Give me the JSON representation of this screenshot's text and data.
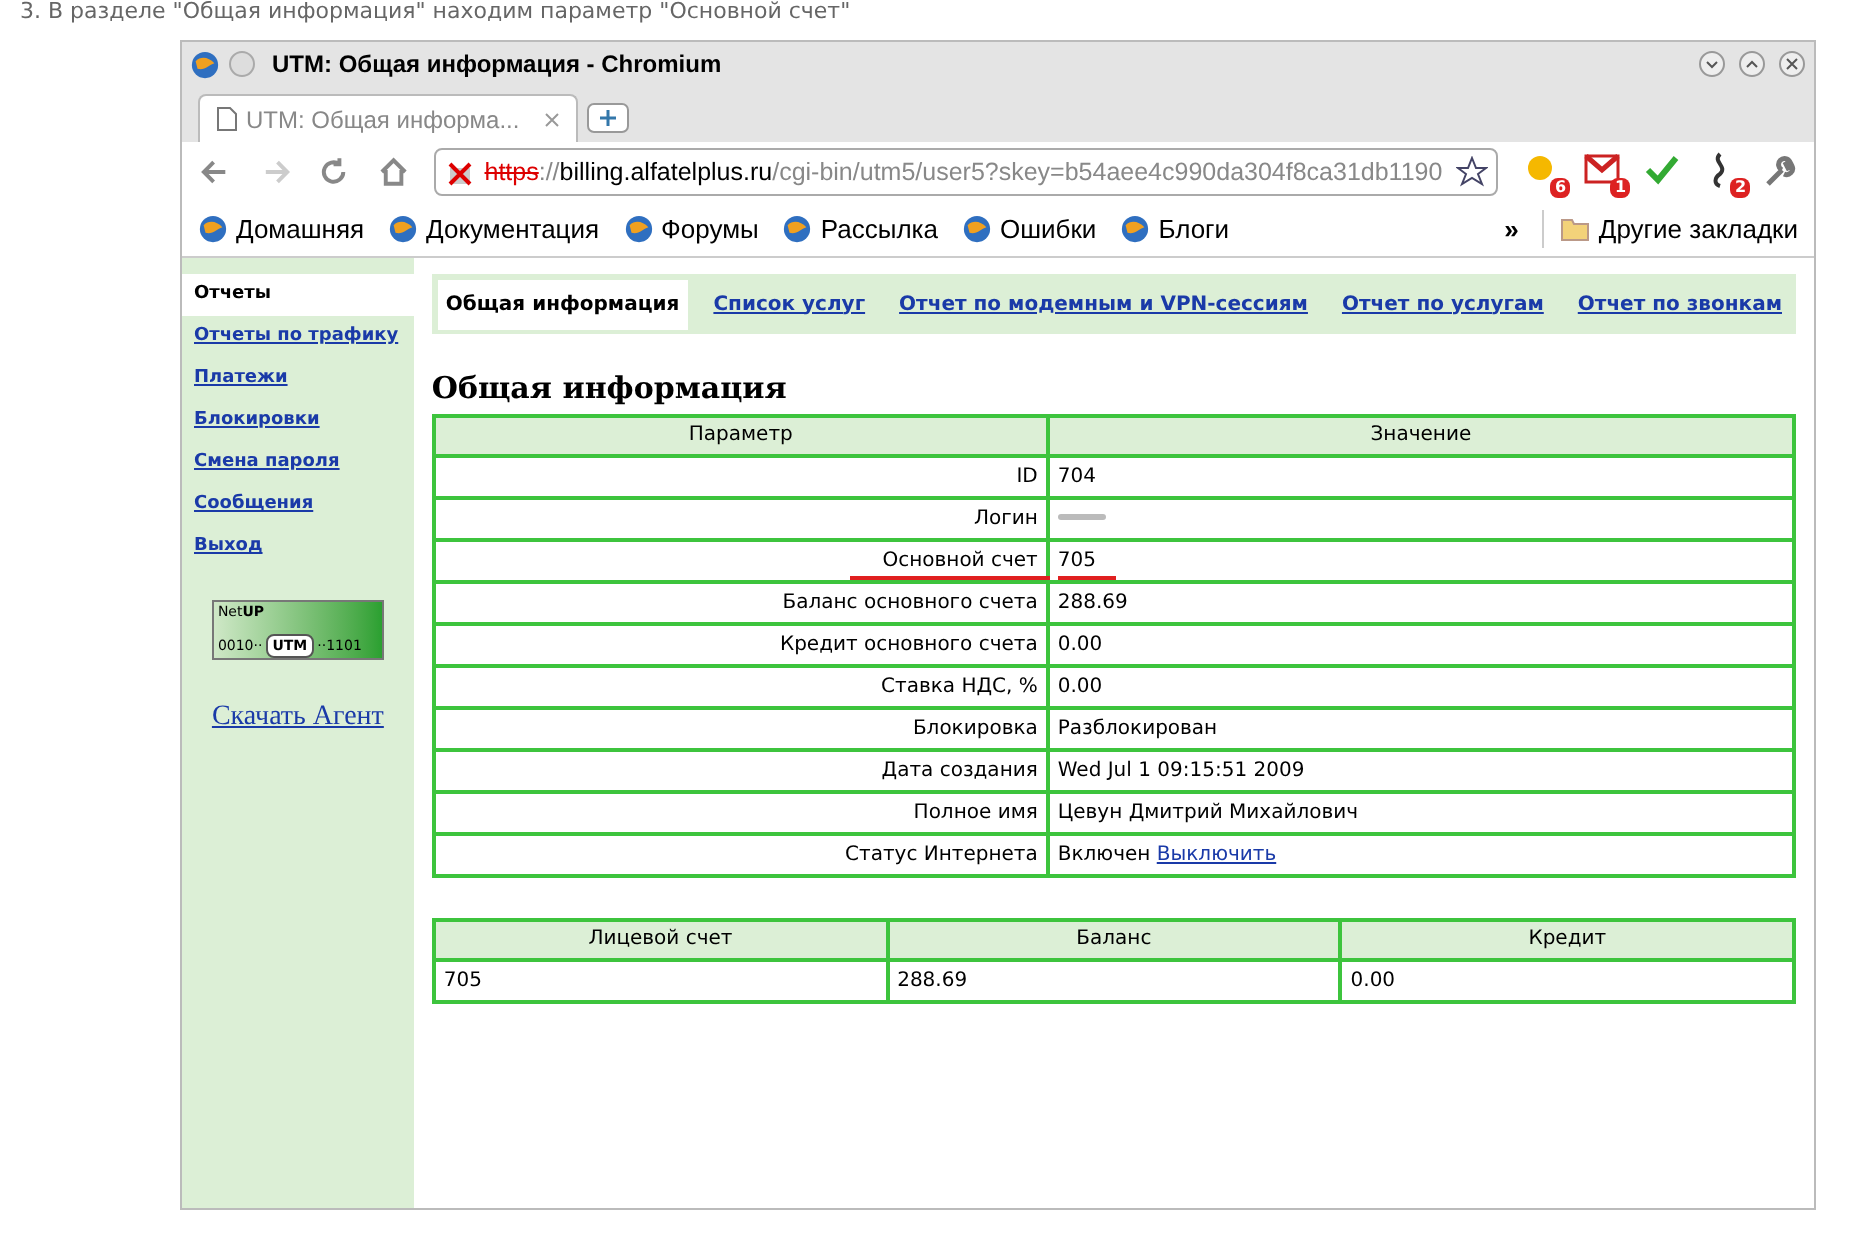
{
  "caption": "3. В разделе \"Общая информация\" находим параметр \"Основной счет\"",
  "browser": {
    "title": "UTM: Общая информация - Chromium",
    "tab_title": "UTM: Общая информа...",
    "url": {
      "scheme": "https",
      "separator": "://",
      "host": "billing.alfatelplus.ru",
      "path": "/cgi-bin/utm5/user5?skey=b54aee4c990da304f8ca31db1190"
    },
    "extensions": [
      {
        "kind": "weather",
        "badge": "6"
      },
      {
        "kind": "mail",
        "badge": "1"
      },
      {
        "kind": "check"
      },
      {
        "kind": "music",
        "badge": "2"
      }
    ],
    "bookmarks": [
      "Домашняя",
      "Документация",
      "Форумы",
      "Рассылка",
      "Ошибки",
      "Блоги"
    ],
    "overflow": "»",
    "other_bookmarks": "Другие закладки"
  },
  "sidebar": {
    "items": [
      {
        "label": "Отчеты",
        "selected": true
      },
      {
        "label": "Отчеты по трафику",
        "selected": false
      },
      {
        "label": "Платежи",
        "selected": false
      },
      {
        "label": "Блокировки",
        "selected": false
      },
      {
        "label": "Смена пароля",
        "selected": false
      },
      {
        "label": "Сообщения",
        "selected": false
      },
      {
        "label": "Выход",
        "selected": false
      }
    ],
    "logo": {
      "brand_light": "Net",
      "brand_bold": "UP",
      "left": "0010··",
      "badge": "UTM",
      "right": "··1101"
    },
    "agent_link": "Скачать Агент"
  },
  "tabs": [
    {
      "label": "Общая информация",
      "selected": true
    },
    {
      "label": "Список услуг",
      "selected": false
    },
    {
      "label": "Отчет по модемным и VPN-сессиям",
      "selected": false
    },
    {
      "label": "Отчет по услугам",
      "selected": false
    },
    {
      "label": "Отчет по звонкам",
      "selected": false
    }
  ],
  "heading": "Общая информация",
  "info_table": {
    "columns": [
      "Параметр",
      "Значение"
    ],
    "rows": [
      {
        "parameter": "ID",
        "kind": "text",
        "value": "704",
        "underlined": false
      },
      {
        "parameter": "Логин",
        "kind": "blurred",
        "underlined": false
      },
      {
        "parameter": "Основной счет",
        "kind": "text",
        "value": "705",
        "underlined": true
      },
      {
        "parameter": "Баланс основного счета",
        "kind": "text",
        "value": "288.69",
        "underlined": false
      },
      {
        "parameter": "Кредит основного счета",
        "kind": "text",
        "value": "0.00",
        "underlined": false
      },
      {
        "parameter": "Ставка НДС, %",
        "kind": "text",
        "value": "0.00",
        "underlined": false
      },
      {
        "parameter": "Блокировка",
        "kind": "text",
        "value": "Разблокирован",
        "underlined": false
      },
      {
        "parameter": "Дата создания",
        "kind": "text",
        "value": "Wed Jul 1 09:15:51 2009",
        "underlined": false
      },
      {
        "parameter": "Полное имя",
        "kind": "text",
        "value": "Цевун Дмитрий Михайлович",
        "underlined": false
      },
      {
        "parameter": "Статус Интернета",
        "kind": "link",
        "value": "Включен",
        "link": "Выключить",
        "underlined": false
      }
    ]
  },
  "account_table": {
    "columns": [
      "Лицевой счет",
      "Баланс",
      "Кредит"
    ],
    "rows": [
      [
        "705",
        "288.69",
        "0.00"
      ]
    ]
  }
}
